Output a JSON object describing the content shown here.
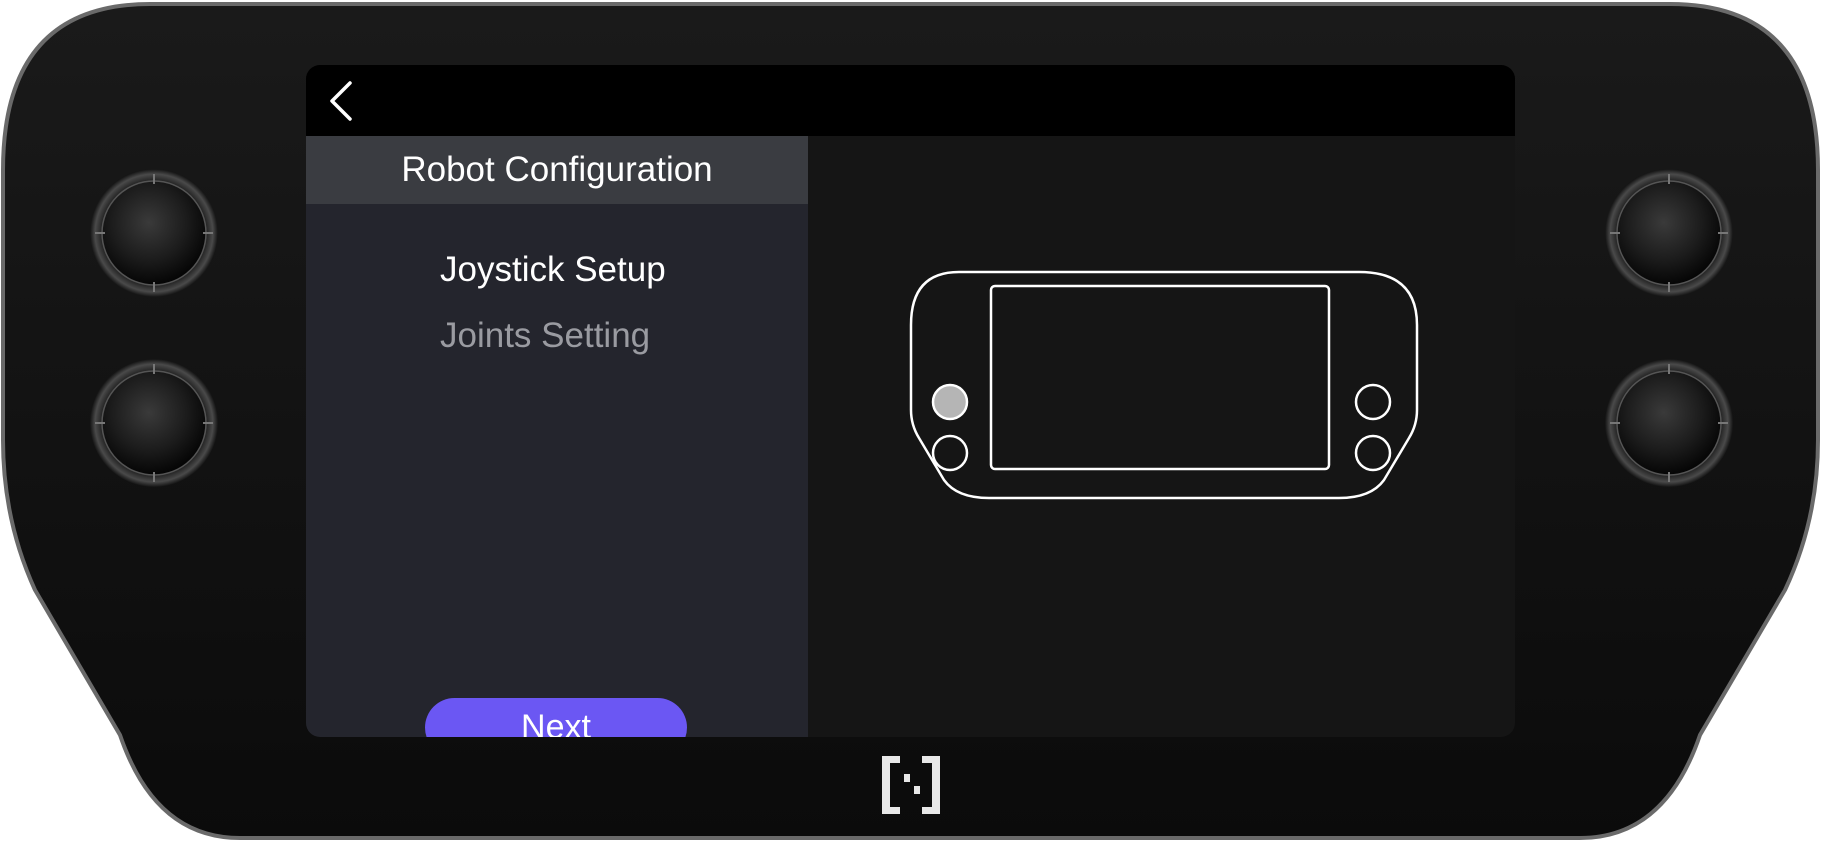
{
  "screen": {
    "header_title": "Robot Configuration",
    "menu_items": [
      {
        "label": "Joystick Setup",
        "state": "active"
      },
      {
        "label": "Joints Setting",
        "state": "inactive"
      }
    ],
    "next_label": "Next"
  },
  "icons": {
    "back": "chevron-left-icon",
    "illustration": "controller-device-icon",
    "logo": "brand-logo"
  },
  "colors": {
    "accent": "#6b57f3",
    "panel_background": "#24252d",
    "header_background": "#3a3c41",
    "screen_background": "#151515",
    "topbar_background": "#000000",
    "inactive_text": "#9a9ba1"
  }
}
